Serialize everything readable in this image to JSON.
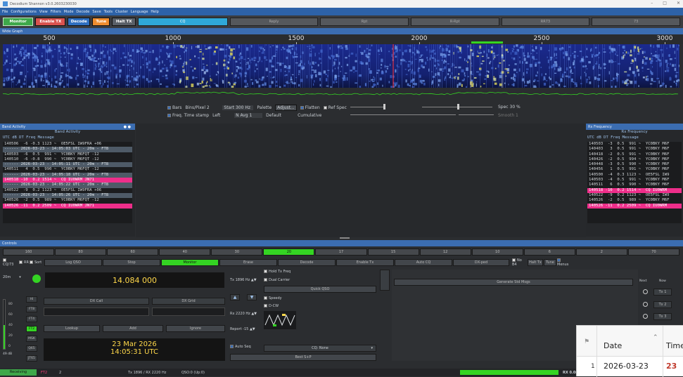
{
  "window": {
    "title": "Decodium Shannon v3.0.2603230030",
    "controls": [
      "–",
      "□",
      "✕"
    ]
  },
  "menu": [
    "File",
    "Configurations",
    "View",
    "Filters",
    "Mode",
    "Decode",
    "Save",
    "Tools",
    "Cluster",
    "Language",
    "Help"
  ],
  "toolbar": {
    "monitor": "Monitor",
    "enable_tx": "Enable TX",
    "decode": "Decode",
    "tune": "Tune",
    "halt_tx": "Halt TX",
    "fields": [
      "CQ",
      "Reply",
      "Rpt",
      "R-Rpt",
      "RR73",
      "73"
    ]
  },
  "wide_graph": {
    "title": "Wide Graph",
    "freq_labels": [
      "500",
      "1000",
      "1500",
      "2000",
      "2500",
      "3000"
    ],
    "controls": {
      "bars": "Bars",
      "bins_per_pixel": "Bins/Pixel 2",
      "start": "Start 300 Hz",
      "palette": "Palette",
      "adjust": "Adjust...",
      "flatten": "Flatten",
      "ref_spec": "Ref Spec",
      "spec": "Spec 30 %",
      "freq_ts": "Freq. Time stamp",
      "ts_pos": "Left",
      "n_avg": "N Avg 1",
      "default": "Default",
      "cumulative": "Cumulative",
      "smooth": "Smooth 1"
    }
  },
  "band_activity": {
    "title": "Band Activity",
    "header": "UTC   dB   DT  Freq    Message",
    "lines": [
      {
        "t": "140506  -6 -0.3 1123 ~  OE5FSL IW9FRA +06",
        "k": ""
      },
      {
        "t": "------ 2026-03-23 - 14:05:03 UTC - 20m - FT8",
        "k": "sep"
      },
      {
        "t": "140503  -6  0.5  991 ~  YC0BKY M6FQT -12",
        "k": ""
      },
      {
        "t": "140510  -6 -0.8  990 ~  YC0BKY M6FQT -12",
        "k": ""
      },
      {
        "t": "------ 2026-03-23 - 14:05:11 UTC - 20m - FT8",
        "k": "sep"
      },
      {
        "t": "140511   4  0.5  990 ~  YC0BKY M6FQT -12",
        "k": ""
      },
      {
        "t": "------ 2026-03-23 - 14:05:18 UTC - 20m - FT8",
        "k": "sep"
      },
      {
        "t": "140518 -10  0.2 1514 ~  CQ IU0WRM JN71",
        "k": "cq"
      },
      {
        "t": "------ 2026-03-23 - 14:05:22 UTC - 20m - FT8",
        "k": "sep"
      },
      {
        "t": "140522  -9  0.2 1123 ~  OE5FSL IW9FRA +06",
        "k": ""
      },
      {
        "t": "------ 2026-03-23 - 14:05:26 UTC - 20m - FT8",
        "k": "sep"
      },
      {
        "t": "140526  -2  0.5  989 ~  YC0BKY M6FQT -12",
        "k": ""
      },
      {
        "t": "140526 -11  0.2 2509 ~  CQ IU0WRM JN71",
        "k": "cq"
      }
    ]
  },
  "rx_frequency": {
    "title": "Rx Frequency",
    "header": "UTC   dB   DT Freq    Message",
    "lines": [
      {
        "t": "140503  -3  0.5  991 ~  YC0BKY M6F",
        "k": ""
      },
      {
        "t": "140403   3  0.5  991 ~  YC0BKY M6F",
        "k": ""
      },
      {
        "t": "140418  -2  0.5  991 ~  YC0BKY M6F",
        "k": ""
      },
      {
        "t": "140426  -2  0.5  994 ~  YC0BKY M6F",
        "k": ""
      },
      {
        "t": "140448  -3  0.5  990 ~  YC0BKY M6F",
        "k": ""
      },
      {
        "t": "140456   1  0.5  991 ~  YC0BKY M6F",
        "k": ""
      },
      {
        "t": "140500  -4  0.3 1123 ~  OE5FSL IW9",
        "k": ""
      },
      {
        "t": "140503  -4  0.5  991 ~  YC0BKY M6F",
        "k": ""
      },
      {
        "t": "140511   6  0.5  990 ~  YC0BKY M6F",
        "k": ""
      },
      {
        "t": "140518 -10  0.2 1514 ~  CQ IU0WRM",
        "k": "cq"
      },
      {
        "t": "140522  -9  0.2 1123 ~  OE5FSL IW9",
        "k": ""
      },
      {
        "t": "140526  -2  0.5  989 ~  YC0BKY M6F",
        "k": ""
      },
      {
        "t": "140526 -11  0.2 2509 ~  CQ IU0WRM",
        "k": "cq"
      }
    ]
  },
  "controls": {
    "title": "Controls",
    "bands": [
      "160",
      "80",
      "60",
      "40",
      "30",
      "20",
      "17",
      "15",
      "12",
      "10",
      "6",
      "2",
      "70"
    ],
    "active_band": "20",
    "row2": {
      "cq_rr": "CQ/73",
      "rr": "RR",
      "sort": "Sort",
      "log_qso": "Log QSO",
      "stop": "Stop",
      "monitor": "Monitor",
      "erase": "Erase",
      "decode": "Decode",
      "enable_tx": "Enable Tx",
      "auto_cq": "Auto CQ",
      "dx_ped": "DX-ped",
      "no_b4": "No B4",
      "halt_tx": "Halt Tx",
      "tune": "Tune",
      "menus": "Menus"
    },
    "band_sel": "20m",
    "frequency": "14.084 000",
    "modes": [
      "Hi",
      "FT8",
      "FT4",
      "FT2",
      "MSK",
      "Q65",
      "JT65"
    ],
    "active_mode": "FT2",
    "dx_call_label": "DX Call",
    "dx_grid_label": "DX Grid",
    "lookup": "Lookup",
    "add": "Add",
    "ignore": "Ignore",
    "date": "23 Mar 2026",
    "time": "14:05:31 UTC",
    "tx_label": "Tx 1896 Hz",
    "rx_label": "Rx 2220 Hz",
    "report": "Report -15",
    "hold_tx": "Hold Tx Freq",
    "dual_carrier": "Dual Carrier",
    "quick_qso": "Quick QSO",
    "speedy": "Speedy",
    "d_cw": "D-CW",
    "auto_seq": "Auto Seq",
    "cq_none": "CQ: None",
    "best_sp": "Best S+P",
    "gen_std": "Generate Std Msgs",
    "next": "Next",
    "now": "Now",
    "tx_buttons": [
      "Tx 1",
      "Tx 2",
      "Tx 3"
    ],
    "level_scale": [
      "80",
      "60",
      "40",
      "20",
      "0"
    ],
    "level_label": "49 dB"
  },
  "status": {
    "receiving": "Receiving",
    "mode": "FT2",
    "count": "2",
    "txrx": "Tx 1896 / RX 2220 Hz",
    "qso": "QSO:0 (Up:0)",
    "rx_level": "RX 0.0s"
  },
  "overlay": {
    "headers": [
      "Date",
      "Time"
    ],
    "row_num": "1",
    "date": "2026-03-23",
    "time": "23"
  },
  "colors": {
    "accent": "#3b6db1",
    "monitor": "#3ea84a",
    "enable_tx": "#d9534f",
    "decode": "#2f6fc0",
    "tune": "#ef8d2f",
    "active_green": "#34d423",
    "cq_highlight": "#ee2e8a"
  }
}
